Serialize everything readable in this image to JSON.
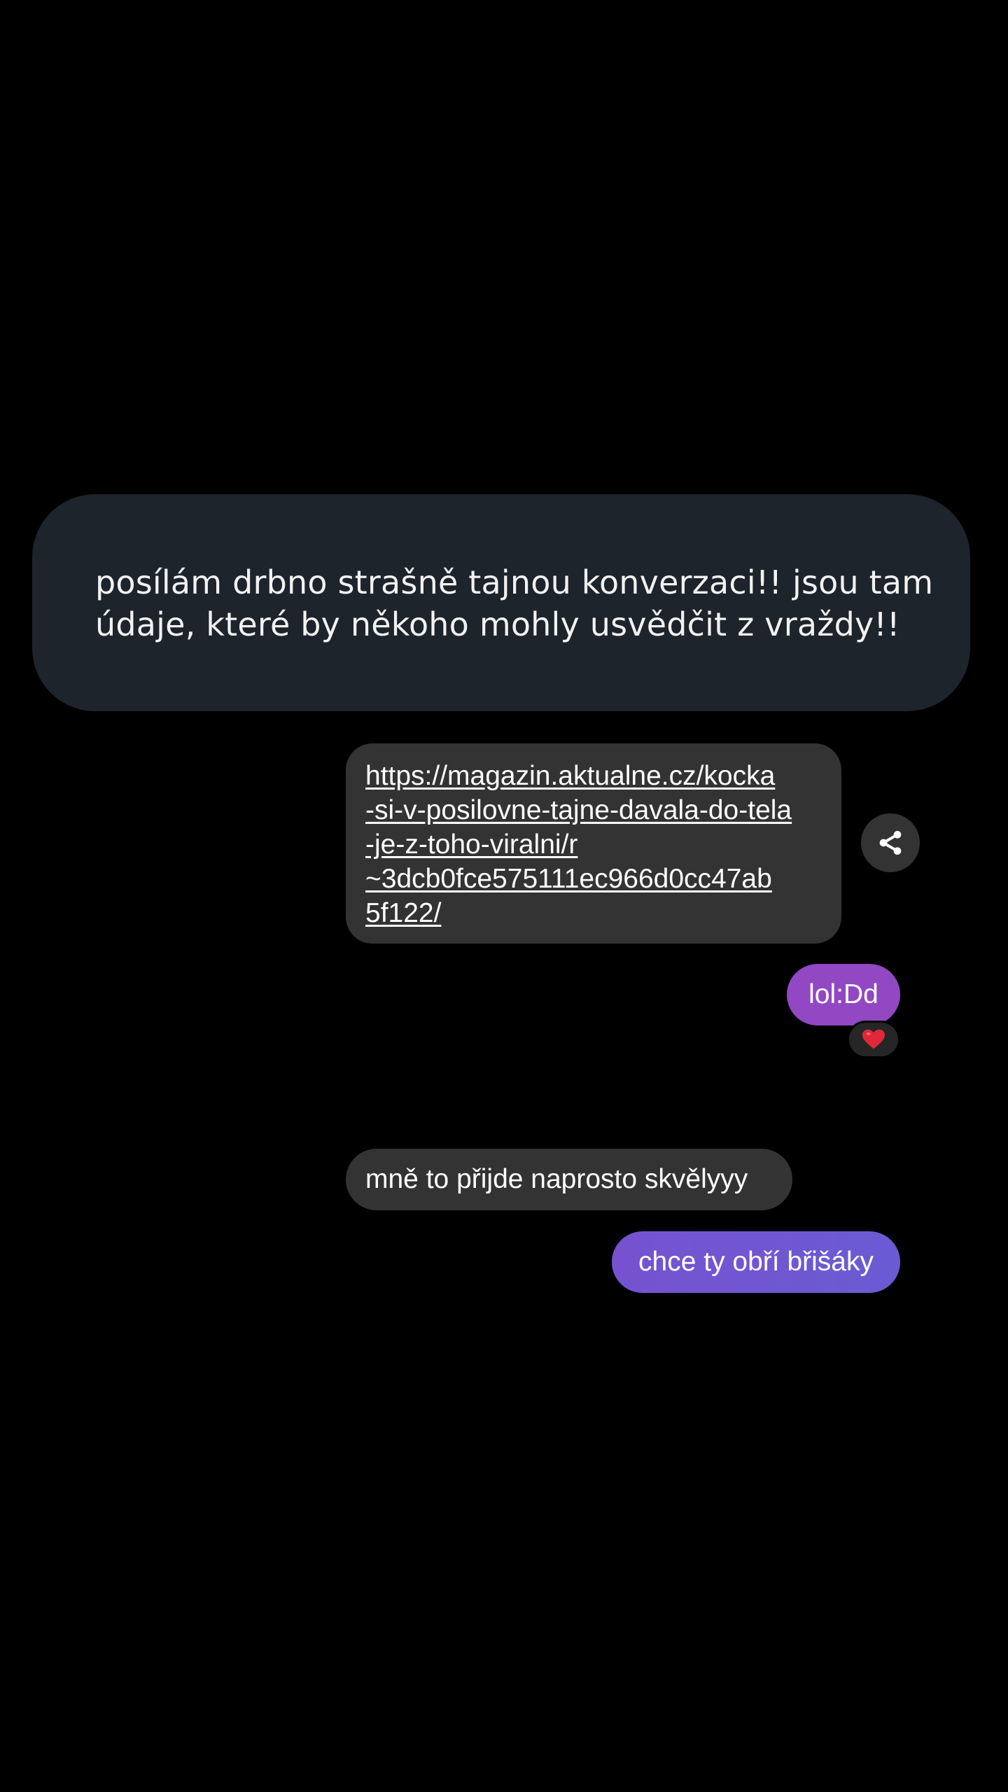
{
  "caption": {
    "line1": "posílám drbno strašně tajnou konverzaci!! jsou tam",
    "line2": "údaje, které by někoho mohly usvědčit z vraždy!!"
  },
  "messages": {
    "link": {
      "lines": [
        "https://magazin.aktualne.cz/kocka",
        "-si-v-posilovne-tajne-davala-do-tela",
        "-je-z-toho-viralni/r",
        "~3dcb0fce575111ec966d0cc47ab",
        "5f122/"
      ],
      "share_icon": "share-icon"
    },
    "outgoing_1": {
      "text": "lol:Dd",
      "reaction": "❤️"
    },
    "incoming_1": {
      "text": "mně to přijde naprosto skvělyyy"
    },
    "outgoing_2": {
      "text": "chce ty obří břišáky"
    }
  },
  "colors": {
    "background": "#000000",
    "caption_bg": "#1e242b",
    "incoming_bubble": "#333333",
    "outgoing_purple": "#9148c2",
    "outgoing_violet": "#7652d0",
    "reaction_heart": "#e0283a"
  }
}
